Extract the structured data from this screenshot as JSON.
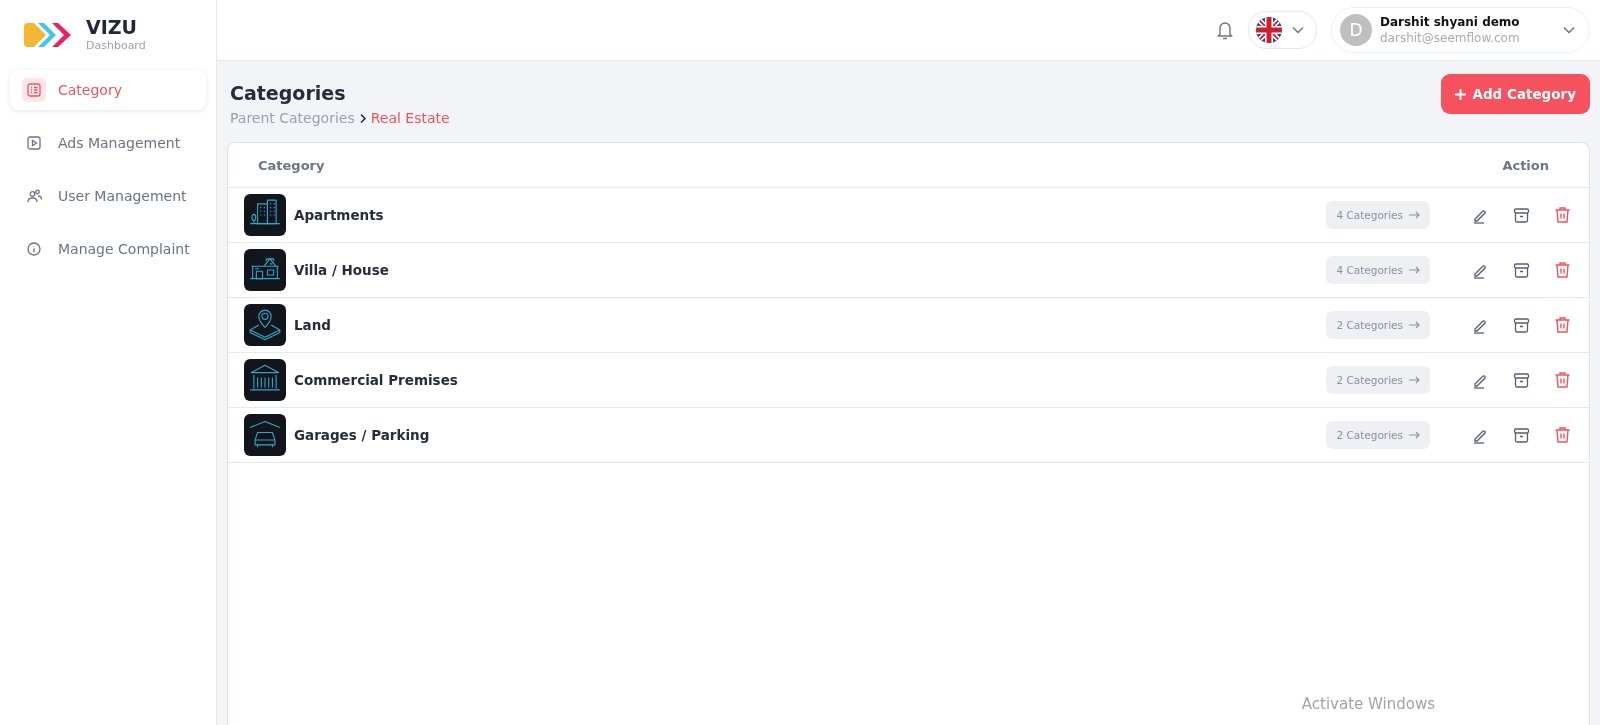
{
  "brand": {
    "name": "VIZU",
    "subtitle": "Dashboard"
  },
  "sidebar": {
    "items": [
      {
        "label": "Category",
        "kind": "list",
        "selected": true
      },
      {
        "label": "Ads Management",
        "kind": "play",
        "selected": false
      },
      {
        "label": "User Management",
        "kind": "users",
        "selected": false
      },
      {
        "label": "Manage Complaint",
        "kind": "info",
        "selected": false
      }
    ]
  },
  "header": {
    "user": {
      "initial": "D",
      "name": "Darshit shyani demo",
      "email": "darshit@seemflow.com"
    }
  },
  "page": {
    "title": "Categories",
    "breadcrumb": [
      {
        "label": "Parent Categories",
        "selected": false
      },
      {
        "label": "Real Estate",
        "selected": true
      }
    ],
    "add_button": "Add Category"
  },
  "table": {
    "columns": [
      "Category",
      "Action"
    ],
    "rows": [
      {
        "kind": "apartments",
        "name": "Apartments",
        "subcategories": "4 Categories"
      },
      {
        "kind": "villa",
        "name": "Villa / House",
        "subcategories": "4 Categories"
      },
      {
        "kind": "land",
        "name": "Land",
        "subcategories": "2 Categories"
      },
      {
        "kind": "commercial",
        "name": "Commercial Premises",
        "subcategories": "2 Categories"
      },
      {
        "kind": "garage",
        "name": "Garages / Parking",
        "subcategories": "2 Categories"
      }
    ]
  },
  "os_notice": "Activate Windows"
}
